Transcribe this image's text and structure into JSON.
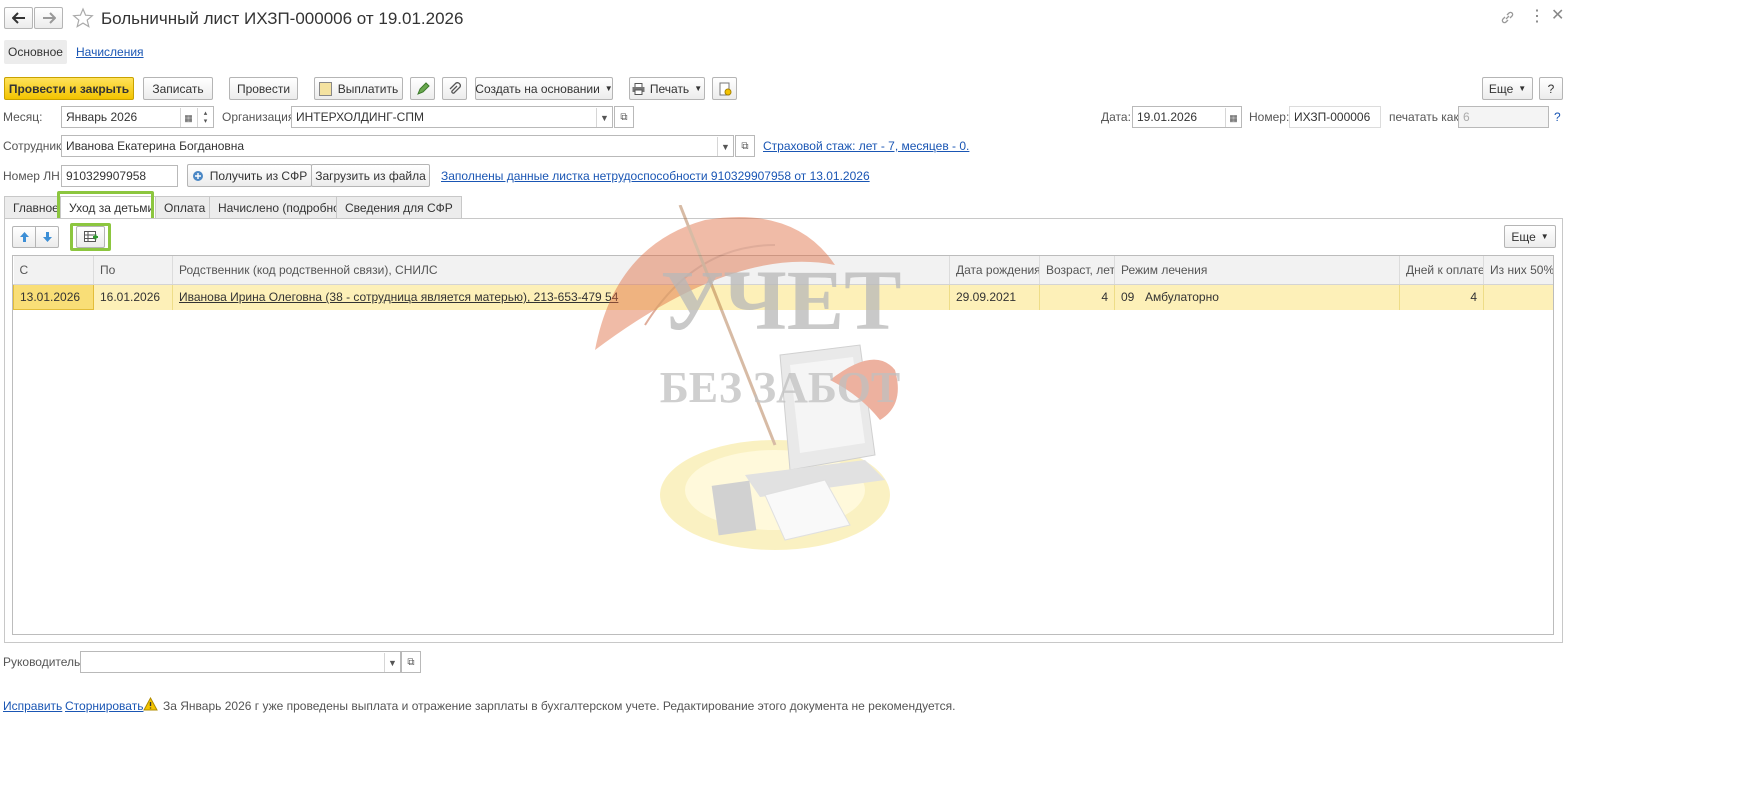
{
  "window": {
    "title": "Больничный лист ИХЗП-000006 от 19.01.2026",
    "nav_tabs": [
      "Основное",
      "Начисления"
    ]
  },
  "toolbar": {
    "post_close": "Провести и закрыть",
    "save": "Записать",
    "post": "Провести",
    "pay": "Выплатить",
    "create_based": "Создать на основании",
    "print": "Печать",
    "more": "Еще",
    "help": "?"
  },
  "form": {
    "month_label": "Месяц:",
    "month_value": "Январь 2026",
    "org_label": "Организация:",
    "org_value": "ИНТЕРХОЛДИНГ-СПМ",
    "date_label": "Дата:",
    "date_value": "19.01.2026",
    "number_label": "Номер:",
    "number_value": "ИХЗП-000006",
    "print_as_label": "печатать как:",
    "print_as_placeholder": "6",
    "print_as_help": "?",
    "employee_label": "Сотрудник:",
    "employee_value": "Иванова Екатерина Богдановна",
    "insurance_link": "Страховой стаж: лет - 7, месяцев - 0.",
    "ln_label": "Номер ЛН:",
    "ln_value": "910329907958",
    "get_sfr": "Получить из СФР",
    "load_file": "Загрузить из файла",
    "filled_link": "Заполнены данные листка нетрудоспособности 910329907958 от 13.01.2026"
  },
  "tabs": [
    "Главное",
    "Уход за детьми",
    "Оплата",
    "Начислено (подробно)",
    "Сведения для СФР"
  ],
  "table_toolbar": {
    "more": "Еще"
  },
  "table": {
    "headers": [
      "С",
      "По",
      "Родственник (код родственной связи), СНИЛС",
      "Дата рождения",
      "Возраст, лет",
      "Режим лечения",
      "Дней к оплате",
      "Из них 50%"
    ],
    "rows": [
      {
        "from": "13.01.2026",
        "to": "16.01.2026",
        "relative": "Иванова Ирина Олеговна (38 - сотрудница является матерью), 213-653-479 54",
        "birth": "29.09.2021",
        "age": "4",
        "mode_code": "09",
        "mode_name": "Амбулаторно",
        "days": "4",
        "half": ""
      }
    ]
  },
  "watermark": {
    "line1": "УЧЕТ",
    "line2": "БЕЗ ЗАБОТ"
  },
  "footer": {
    "manager_label": "Руководитель:",
    "manager_value": "",
    "fix_link": "Исправить",
    "reverse_link": "Сторнировать",
    "warning": "За Январь 2026 г уже проведены выплата и отражение зарплаты в бухгалтерском учете. Редактирование этого документа не рекомендуется."
  },
  "colors": {
    "accent": "#f3c400",
    "highlight": "#8cc63f",
    "link": "#1a56b4",
    "row_selected": "#fdf0b8"
  }
}
